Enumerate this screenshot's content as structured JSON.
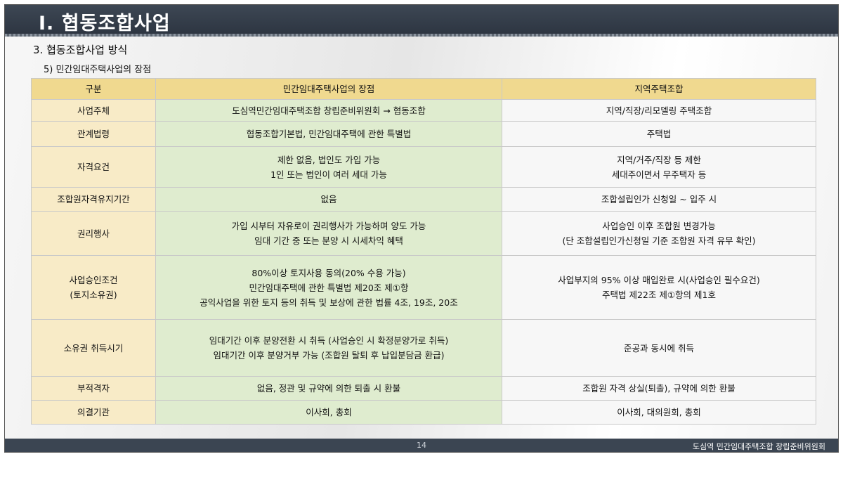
{
  "header": {
    "title": "Ⅰ. 협동조합사업"
  },
  "section": {
    "title": "3. 협동조합사업 방식",
    "subtitle": "5) 민간임대주택사업의 장점"
  },
  "table": {
    "headers": [
      "구분",
      "민간임대주택사업의 장점",
      "지역주택조합"
    ],
    "rows": [
      {
        "category": [
          "사업주체"
        ],
        "advantage": [
          "도심역민간임대주택조합 창립준비위원회 → 협동조합"
        ],
        "regional": [
          "지역/직장/리모델링 주택조합"
        ]
      },
      {
        "category": [
          "관계법령"
        ],
        "advantage": [
          "협동조합기본법, 민간임대주택에 관한 특별법"
        ],
        "regional": [
          "주택법"
        ]
      },
      {
        "category": [
          "자격요건"
        ],
        "advantage": [
          "제한 없음, 법인도 가입 가능",
          "1인 또는 법인이 여러 세대 가능"
        ],
        "regional": [
          "지역/거주/직장 등 제한",
          "세대주이면서 무주택자 등"
        ]
      },
      {
        "category": [
          "조합원자격유지기간"
        ],
        "advantage": [
          "없음"
        ],
        "regional": [
          "조합설립인가 신청일 ~ 입주 시"
        ]
      },
      {
        "category": [
          "권리행사"
        ],
        "advantage": [
          "가입 시부터 자유로이 권리행사가 가능하며 양도 가능",
          "임대 기간 중 또는 분양 시 시세차익 혜택"
        ],
        "regional": [
          "사업승인 이후 조합원 변경가능",
          "(단 조합설립인가신청일 기준 조합원 자격 유무 확인)"
        ]
      },
      {
        "category": [
          "사업승인조건",
          "(토지소유권)"
        ],
        "advantage": [
          "80%이상 토지사용 동의(20% 수용 가능)",
          "민간임대주택에 관한 특별법 제20조 제①항",
          "공익사업을 위한 토지 등의  취득 및 보상에  관한 법률 4조, 19조, 20조"
        ],
        "regional": [
          "사업부지의 95% 이상 매입완료 시(사업승인 필수요건)",
          "주택법 제22조 제①항의 제1호"
        ]
      },
      {
        "category": [
          "소유권 취득시기"
        ],
        "advantage": [
          "임대기간 이후 분양전환 시 취득 (사업승인 시 확정분양가로 취득)",
          "임대기간 이후 분양거부 가능 (조합원 탈퇴 후 납입분담금 환급)"
        ],
        "regional": [
          "준공과 동시에 취득"
        ]
      },
      {
        "category": [
          "부적격자"
        ],
        "advantage": [
          "없음, 정관 및 규약에 의한 퇴출 시 환불"
        ],
        "regional": [
          "조합원 자격 상실(퇴출), 규약에 의한 환불"
        ]
      },
      {
        "category": [
          "의결기관"
        ],
        "advantage": [
          "이사회, 총회"
        ],
        "regional": [
          "이사회, 대의원회, 총회"
        ]
      }
    ]
  },
  "footer": {
    "page": "14",
    "org": "도심역 민간임대주택조합 창립준비위원회"
  },
  "colors": {
    "header_bg": "#2c3440",
    "table_header": "#f0d98f",
    "category_col": "#f8ebc7",
    "advantage_col": "#dfeccf",
    "regional_col": "#f7f7f7"
  }
}
